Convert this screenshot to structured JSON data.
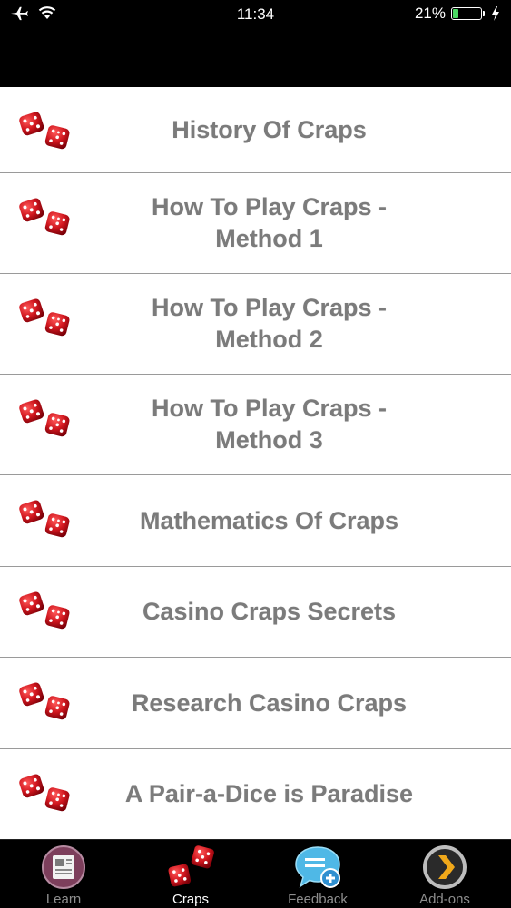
{
  "status_bar": {
    "time": "11:34",
    "battery_percent": "21%",
    "battery_level": 0.21,
    "icons": [
      "airplane-icon",
      "wifi-icon",
      "battery-icon",
      "charging-bolt-icon"
    ]
  },
  "list": {
    "items": [
      {
        "title": "History Of Craps"
      },
      {
        "title": "How To Play Craps - Method 1"
      },
      {
        "title": "How To Play Craps - Method 2"
      },
      {
        "title": "How To Play Craps - Method 3"
      },
      {
        "title": "Mathematics Of Craps"
      },
      {
        "title": "Casino Craps Secrets"
      },
      {
        "title": "Research Casino Craps"
      },
      {
        "title": "A Pair-a-Dice is Paradise"
      }
    ],
    "item_icon": "dice-icon"
  },
  "tab_bar": {
    "tabs": [
      {
        "label": "Learn",
        "icon": "newspaper-icon",
        "active": false
      },
      {
        "label": "Craps",
        "icon": "dice-icon",
        "active": true
      },
      {
        "label": "Feedback",
        "icon": "speech-bubble-plus-icon",
        "active": false
      },
      {
        "label": "Add-ons",
        "icon": "chevron-right-icon",
        "active": false
      }
    ]
  },
  "colors": {
    "list_text": "#7b7b7b",
    "separator": "#9a9a9a",
    "dice_red": "#d0161e",
    "battery_green": "#4cd964"
  }
}
